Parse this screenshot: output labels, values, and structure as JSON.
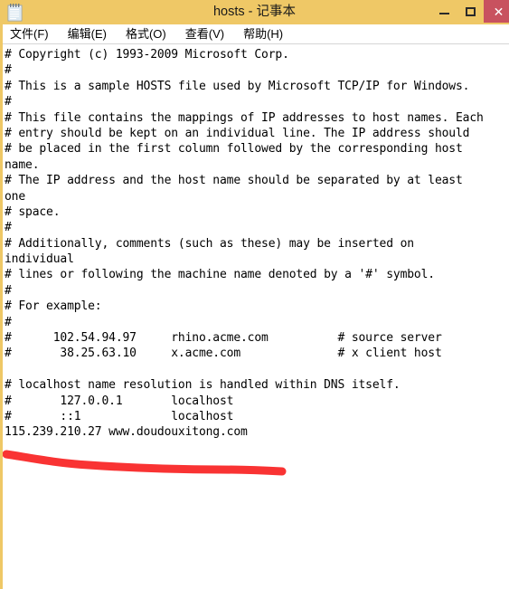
{
  "window": {
    "title": "hosts - 记事本",
    "icon": "notepad-icon",
    "titlebar_color": "#efc866",
    "close_button_color": "#c8525f"
  },
  "window_controls": {
    "minimize_label": "—",
    "maximize_label": "▢",
    "close_label": "✕"
  },
  "menubar": {
    "items": [
      {
        "label": "文件(F)"
      },
      {
        "label": "编辑(E)"
      },
      {
        "label": "格式(O)"
      },
      {
        "label": "查看(V)"
      },
      {
        "label": "帮助(H)"
      }
    ]
  },
  "document": {
    "filename": "hosts",
    "word_wrap": true,
    "lines": [
      "# Copyright (c) 1993-2009 Microsoft Corp.",
      "#",
      "# This is a sample HOSTS file used by Microsoft TCP/IP for Windows.",
      "#",
      "# This file contains the mappings of IP addresses to host names. Each",
      "# entry should be kept on an individual line. The IP address should",
      "# be placed in the first column followed by the corresponding host",
      "name.",
      "# The IP address and the host name should be separated by at least",
      "one",
      "# space.",
      "#",
      "# Additionally, comments (such as these) may be inserted on",
      "individual",
      "# lines or following the machine name denoted by a '#' symbol.",
      "#",
      "# For example:",
      "#",
      "#      102.54.94.97     rhino.acme.com          # source server",
      "#       38.25.63.10     x.acme.com              # x client host",
      "",
      "# localhost name resolution is handled within DNS itself.",
      "#       127.0.0.1       localhost",
      "#       ::1             localhost",
      "115.239.210.27 www.doudouxitong.com"
    ]
  },
  "annotation": {
    "type": "underline-stroke",
    "color": "#f93333",
    "target_line": "115.239.210.27 www.doudouxitong.com"
  }
}
